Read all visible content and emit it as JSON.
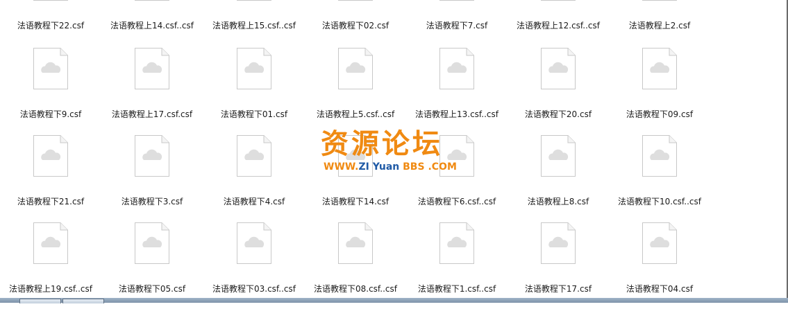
{
  "icons": {
    "file": "blank-document-cloud-icon"
  },
  "colors": {
    "icon_border": "#c8c8c8",
    "cloud": "#dedede",
    "watermark_orange": "#f08a12",
    "watermark_blue": "#1f5aa6"
  },
  "files": [
    [
      "法语教程下22.csf",
      "法语教程上14.csf..csf",
      "法语教程上15.csf..csf",
      "法语教程下02.csf",
      "法语教程下7.csf",
      "法语教程上12.csf..csf",
      "法语教程上2.csf"
    ],
    [
      "法语教程下9.csf",
      "法语教程上17.csf.csf",
      "法语教程下01.csf",
      "法语教程上5.csf..csf",
      "法语教程上13.csf..csf",
      "法语教程下20.csf",
      "法语教程下09.csf"
    ],
    [
      "法语教程下21.csf",
      "法语教程下3.csf",
      "法语教程下4.csf",
      "法语教程下14.csf",
      "法语教程下6.csf..csf",
      "法语教程上8.csf",
      "法语教程下10.csf..csf"
    ],
    [
      "法语教程上19.csf..csf",
      "法语教程下05.csf",
      "法语教程下03.csf..csf",
      "法语教程下08.csf..csf",
      "法语教程下1.csf..csf",
      "法语教程下17.csf",
      "法语教程下04.csf"
    ]
  ],
  "watermark": {
    "title": "资源论坛",
    "url_parts": [
      "WWW.",
      "ZI",
      " Yuan ",
      "BBS",
      " .COM"
    ]
  }
}
